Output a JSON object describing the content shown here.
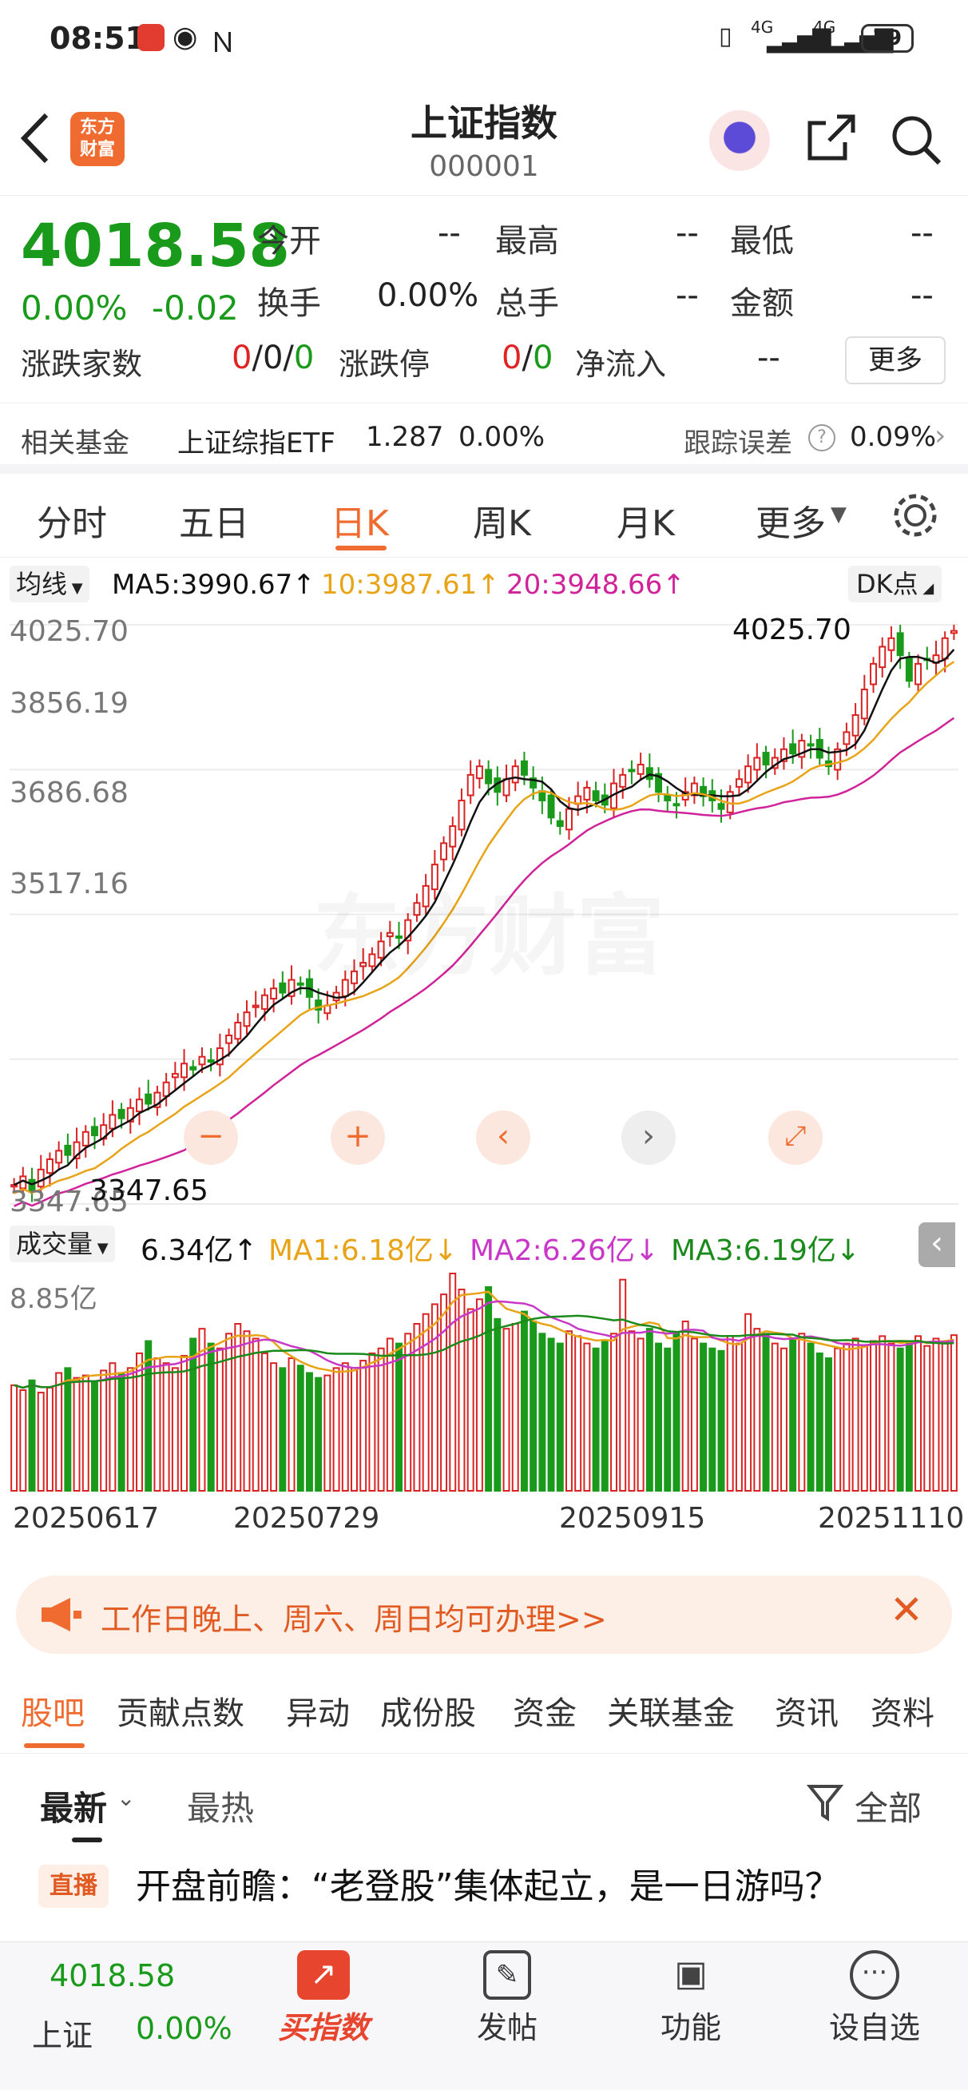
{
  "status_bar": {
    "time": "08:51",
    "battery": "79",
    "signal1": "4G",
    "signal2": "4G"
  },
  "header": {
    "title": "上证指数",
    "code": "000001",
    "logo_line1": "东方",
    "logo_line2": "财富"
  },
  "quote": {
    "price": "4018.58",
    "change_pct": "0.00%",
    "change": "-0.02",
    "open_label": "今开",
    "open": "--",
    "high_label": "最高",
    "high": "--",
    "low_label": "最低",
    "low": "--",
    "turnover_label": "换手",
    "turnover": "0.00%",
    "volume_label": "总手",
    "volume": "--",
    "amount_label": "金额",
    "amount": "--",
    "breadth_label": "涨跌家数",
    "breadth_up": "0",
    "breadth_sep1": "/",
    "breadth_flat": "0",
    "breadth_sep2": "/",
    "breadth_down": "0",
    "limit_label": "涨跌停",
    "limit_up": "0",
    "limit_sep": "/",
    "limit_down": "0",
    "netflow_label": "净流入",
    "netflow": "--",
    "more_button": "更多"
  },
  "fund": {
    "label": "相关基金",
    "name": "上证综指ETF",
    "price": "1.287",
    "pct": "0.00%",
    "tracking_label": "跟踪误差",
    "tracking": "0.09%"
  },
  "tabs": [
    "分时",
    "五日",
    "日K",
    "周K",
    "月K",
    "更多"
  ],
  "active_tab": "日K",
  "ma_legend": {
    "selector": "均线",
    "ma5": "MA5:3990.67↑",
    "ma10": "10:3987.61↑",
    "ma20": "20:3948.66↑",
    "dk": "DK点"
  },
  "colors": {
    "ma5": "#111111",
    "ma10": "#e8a317",
    "ma20": "#d0239a",
    "up": "#d92323",
    "down": "#1a9a1a",
    "accent": "#f06b2f",
    "vol_ma1": "#e8a317",
    "vol_ma2": "#c837c8",
    "vol_ma3": "#1a8a1a"
  },
  "chart_axis": {
    "y_labels": [
      "4025.70",
      "3856.19",
      "3686.68",
      "3517.16",
      "3347.65"
    ],
    "max_marker": "4025.70",
    "min_marker": "3347.65",
    "watermark": "东方财富"
  },
  "chart_data": {
    "type": "candlestick",
    "ylim": [
      3347.65,
      4025.7
    ],
    "x_start": "20250617",
    "x_end": "20251110",
    "closes": [
      3370,
      3380,
      3362,
      3388,
      3400,
      3410,
      3405,
      3420,
      3432,
      3428,
      3440,
      3452,
      3448,
      3460,
      3470,
      3465,
      3478,
      3490,
      3500,
      3512,
      3505,
      3520,
      3515,
      3530,
      3545,
      3560,
      3572,
      3580,
      3592,
      3600,
      3595,
      3610,
      3605,
      3590,
      3575,
      3580,
      3595,
      3610,
      3620,
      3630,
      3640,
      3655,
      3665,
      3660,
      3680,
      3700,
      3720,
      3745,
      3770,
      3790,
      3820,
      3850,
      3860,
      3840,
      3830,
      3845,
      3860,
      3850,
      3835,
      3820,
      3800,
      3790,
      3810,
      3825,
      3835,
      3820,
      3815,
      3840,
      3850,
      3855,
      3862,
      3845,
      3830,
      3820,
      3815,
      3830,
      3840,
      3825,
      3820,
      3810,
      3830,
      3845,
      3860,
      3870,
      3862,
      3870,
      3880,
      3875,
      3890,
      3885,
      3870,
      3860,
      3880,
      3900,
      3920,
      3950,
      3980,
      4000,
      4010,
      3990,
      3960,
      3980,
      3985,
      3990,
      4010,
      4018.58
    ],
    "volume_label": "成交量",
    "volume_current": "6.34亿↑",
    "vol_ma1": "MA1:6.18亿↓",
    "vol_ma2": "MA2:6.26亿↓",
    "vol_ma3": "MA3:6.19亿↓",
    "vol_max_label": "8.85亿",
    "volumes": [
      4.3,
      4.1,
      4.5,
      4.0,
      4.2,
      4.8,
      5.0,
      4.6,
      4.7,
      4.4,
      4.9,
      5.2,
      4.8,
      5.0,
      5.6,
      6.1,
      5.4,
      5.2,
      5.0,
      5.5,
      6.2,
      6.6,
      6.0,
      5.8,
      6.4,
      6.8,
      6.5,
      6.2,
      5.6,
      5.2,
      5.0,
      5.4,
      5.1,
      4.8,
      4.6,
      4.7,
      5.0,
      5.2,
      5.0,
      5.3,
      5.6,
      5.8,
      6.2,
      6.0,
      6.4,
      6.8,
      7.2,
      7.6,
      8.0,
      8.85,
      8.2,
      7.4,
      7.8,
      8.3,
      7.0,
      6.6,
      6.8,
      7.3,
      6.9,
      6.4,
      6.2,
      6.0,
      6.5,
      6.3,
      6.0,
      5.8,
      6.1,
      6.4,
      8.6,
      6.5,
      6.2,
      6.6,
      6.0,
      5.8,
      6.4,
      6.9,
      6.2,
      6.0,
      5.8,
      5.7,
      6.3,
      6.0,
      7.2,
      6.6,
      6.4,
      6.0,
      5.8,
      6.2,
      6.4,
      6.0,
      5.6,
      5.4,
      5.8,
      6.0,
      6.2,
      5.9,
      6.1,
      6.3,
      6.0,
      5.8,
      6.1,
      6.3,
      5.9,
      6.2,
      6.0,
      6.34
    ],
    "x_labels": [
      "20250617",
      "20250729",
      "20250915",
      "20251110"
    ]
  },
  "banner": {
    "text": "工作日晚上、周六、周日均可办理>>"
  },
  "guba_tabs": [
    "股吧",
    "贡献点数",
    "异动",
    "成份股",
    "资金",
    "关联基金",
    "资讯",
    "资料"
  ],
  "feed_tabs": {
    "latest": "最新",
    "hot": "最热",
    "filter": "全部"
  },
  "post": {
    "tag": "直播",
    "title": "开盘前瞻：“老登股”集体起立，是一日游吗？"
  },
  "bottom_bar": {
    "price": "4018.58",
    "name": "上证",
    "pct": "0.00%",
    "buy_label": "买指数",
    "post_label": "发帖",
    "func_label": "功能",
    "watch_label": "设自选"
  }
}
